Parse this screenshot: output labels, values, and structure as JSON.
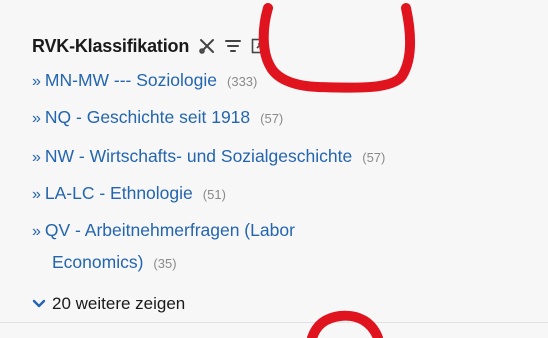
{
  "facet": {
    "title": "RVK-Klassifikation",
    "items": [
      {
        "label": "MN-MW --- Soziologie",
        "count": "(333)"
      },
      {
        "label": "NQ - Geschichte seit 1918",
        "count": "(57)"
      },
      {
        "label": "NW - Wirtschafts- und Sozialgeschichte",
        "count": "(57)"
      },
      {
        "label": "LA-LC - Ethnologie",
        "count": "(51)"
      },
      {
        "label": "QV - Arbeitnehmerfragen (Labor",
        "label_cont": "Economics)",
        "count": "(35)"
      }
    ],
    "more_label": "20 weitere zeigen",
    "bullet": "»"
  },
  "icons": {
    "tool_1": "scissors-icon",
    "tool_2": "sort-lines-icon",
    "tool_3": "expand-window-icon",
    "more": "chevron-down-icon"
  },
  "colors": {
    "link": "#2465b0",
    "count": "#8a8a8a",
    "annotation": "#e0141e"
  }
}
